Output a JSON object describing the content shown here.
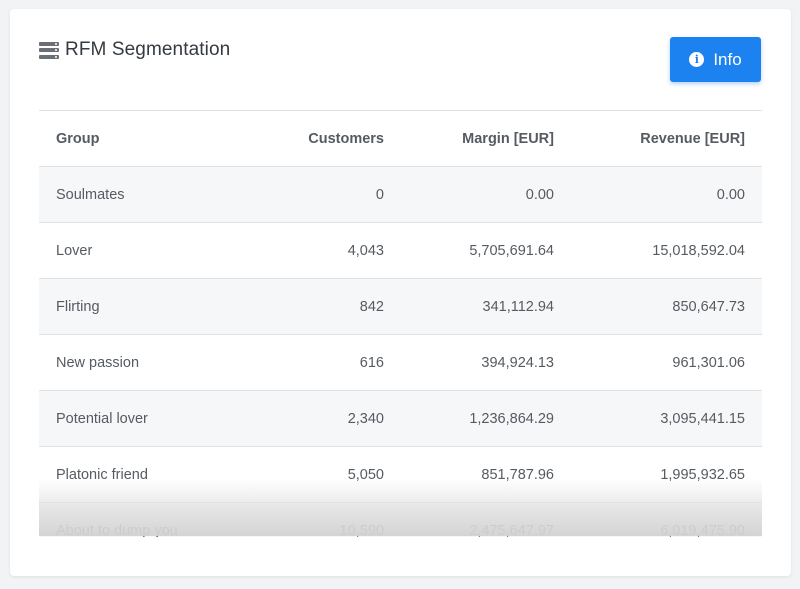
{
  "panel": {
    "title": "RFM Segmentation",
    "title_icon": "server-icon",
    "info_button": {
      "label": "Info",
      "icon": "info-circle-icon",
      "color": "#1c82f0"
    }
  },
  "table": {
    "headers": [
      "Group",
      "Customers",
      "Margin [EUR]",
      "Revenue [EUR]"
    ],
    "rows": [
      [
        "Soulmates",
        "0",
        "0.00",
        "0.00"
      ],
      [
        "Lover",
        "4,043",
        "5,705,691.64",
        "15,018,592.04"
      ],
      [
        "Flirting",
        "842",
        "341,112.94",
        "850,647.73"
      ],
      [
        "New passion",
        "616",
        "394,924.13",
        "961,301.06"
      ],
      [
        "Potential lover",
        "2,340",
        "1,236,864.29",
        "3,095,441.15"
      ],
      [
        "Platonic friend",
        "5,050",
        "851,787.96",
        "1,995,932.65"
      ],
      [
        "About to dump you",
        "10,590",
        "2,475,647.97",
        "6,019,475.90"
      ]
    ]
  }
}
